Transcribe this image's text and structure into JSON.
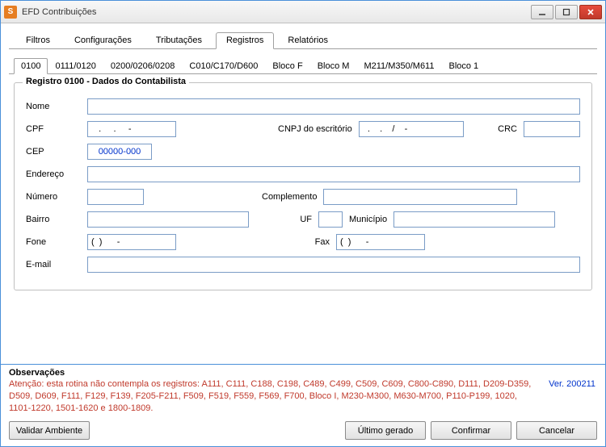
{
  "window": {
    "title": "EFD Contribuições"
  },
  "main_tabs": {
    "filtros": "Filtros",
    "config": "Configurações",
    "tribut": "Tributações",
    "registros": "Registros",
    "relatorios": "Relatórios"
  },
  "sub_tabs": {
    "t0100": "0100",
    "t0111": "0111/0120",
    "t0200": "0200/0206/0208",
    "tc010": "C010/C170/D600",
    "tblocof": "Bloco F",
    "tblocom": "Bloco M",
    "tm211": "M211/M350/M611",
    "tbloco1": "Bloco 1"
  },
  "group": {
    "title": "Registro 0100 - Dados do Contabilista"
  },
  "fields": {
    "nome_label": "Nome",
    "nome_value": "",
    "cpf_label": "CPF",
    "cpf_value": "   .     .     -",
    "cnpj_label": "CNPJ do escritório",
    "cnpj_value": "  .    .    /    -",
    "crc_label": "CRC",
    "crc_value": "",
    "cep_label": "CEP",
    "cep_value": "00000-000",
    "endereco_label": "Endereço",
    "endereco_value": "",
    "numero_label": "Número",
    "numero_value": "",
    "complemento_label": "Complemento",
    "complemento_value": "",
    "bairro_label": "Bairro",
    "bairro_value": "",
    "uf_label": "UF",
    "uf_value": "",
    "municipio_label": "Município",
    "municipio_value": "",
    "fone_label": "Fone",
    "fone_value": "(  )      -",
    "fax_label": "Fax",
    "fax_value": "(  )      -",
    "email_label": "E-mail",
    "email_value": ""
  },
  "obs": {
    "title": "Observações",
    "body": "Atenção: esta rotina não contempla os registros: A111, C111, C188, C198, C489, C499, C509, C609, C800-C890, D111, D209-D359, D509, D609, F111, F129, F139, F205-F211, F509, F519, F559, F569, F700, Bloco I, M230-M300, M630-M700, P110-P199, 1020, 1101-1220, 1501-1620 e 1800-1809."
  },
  "version": "Ver. 200211",
  "buttons": {
    "validar": "Validar Ambiente",
    "ultimo": "Último gerado",
    "confirmar": "Confirmar",
    "cancelar": "Cancelar"
  }
}
